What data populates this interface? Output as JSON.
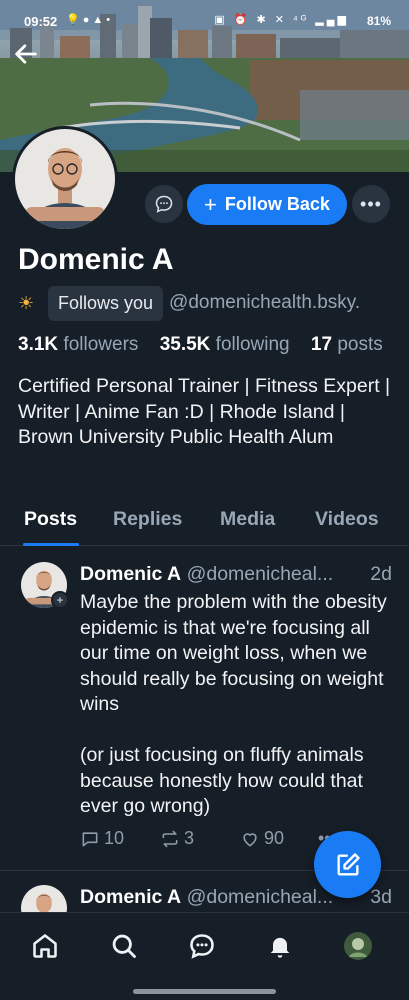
{
  "status_bar": {
    "time": "09:52",
    "left_icons": [
      "bulb-icon",
      "chat-bubble-icon",
      "messenger-icon",
      "dot-icon"
    ],
    "right_icons": [
      "sim-icon",
      "alarm-icon",
      "bluetooth-icon",
      "mute-icon",
      "4g-icon",
      "signal-icon"
    ],
    "battery": "81%"
  },
  "profile": {
    "display_name": "Domenic A",
    "follows_you": "Follows you",
    "handle": "@domenichealth.bsky.",
    "followers_count": "3.1K",
    "followers_label": "followers",
    "following_count": "35.5K",
    "following_label": "following",
    "posts_count": "17",
    "posts_label": "posts",
    "bio": "Certified Personal Trainer | Fitness Expert | Writer | Anime Fan :D | Rhode Island | Brown University Public Health Alum"
  },
  "buttons": {
    "follow_back": "Follow Back"
  },
  "tabs": [
    {
      "label": "Posts",
      "active": true
    },
    {
      "label": "Replies",
      "active": false
    },
    {
      "label": "Media",
      "active": false
    },
    {
      "label": "Videos",
      "active": false
    }
  ],
  "posts": [
    {
      "name": "Domenic A",
      "handle": "@domenicheal...",
      "time": "2d",
      "text": "Maybe the problem with the obesity epidemic is that we're focusing all our time on weight loss, when we should really be focusing on weight wins\n\n(or just focusing on fluffy animals because honestly how could that ever go wrong)",
      "replies": "10",
      "reposts": "3",
      "likes": "90"
    },
    {
      "name": "Domenic A",
      "handle": "@domenicheal...",
      "time": "3d"
    }
  ],
  "colors": {
    "background": "#161e27",
    "accent": "#1a7cf5",
    "muted": "#97a6b4"
  }
}
